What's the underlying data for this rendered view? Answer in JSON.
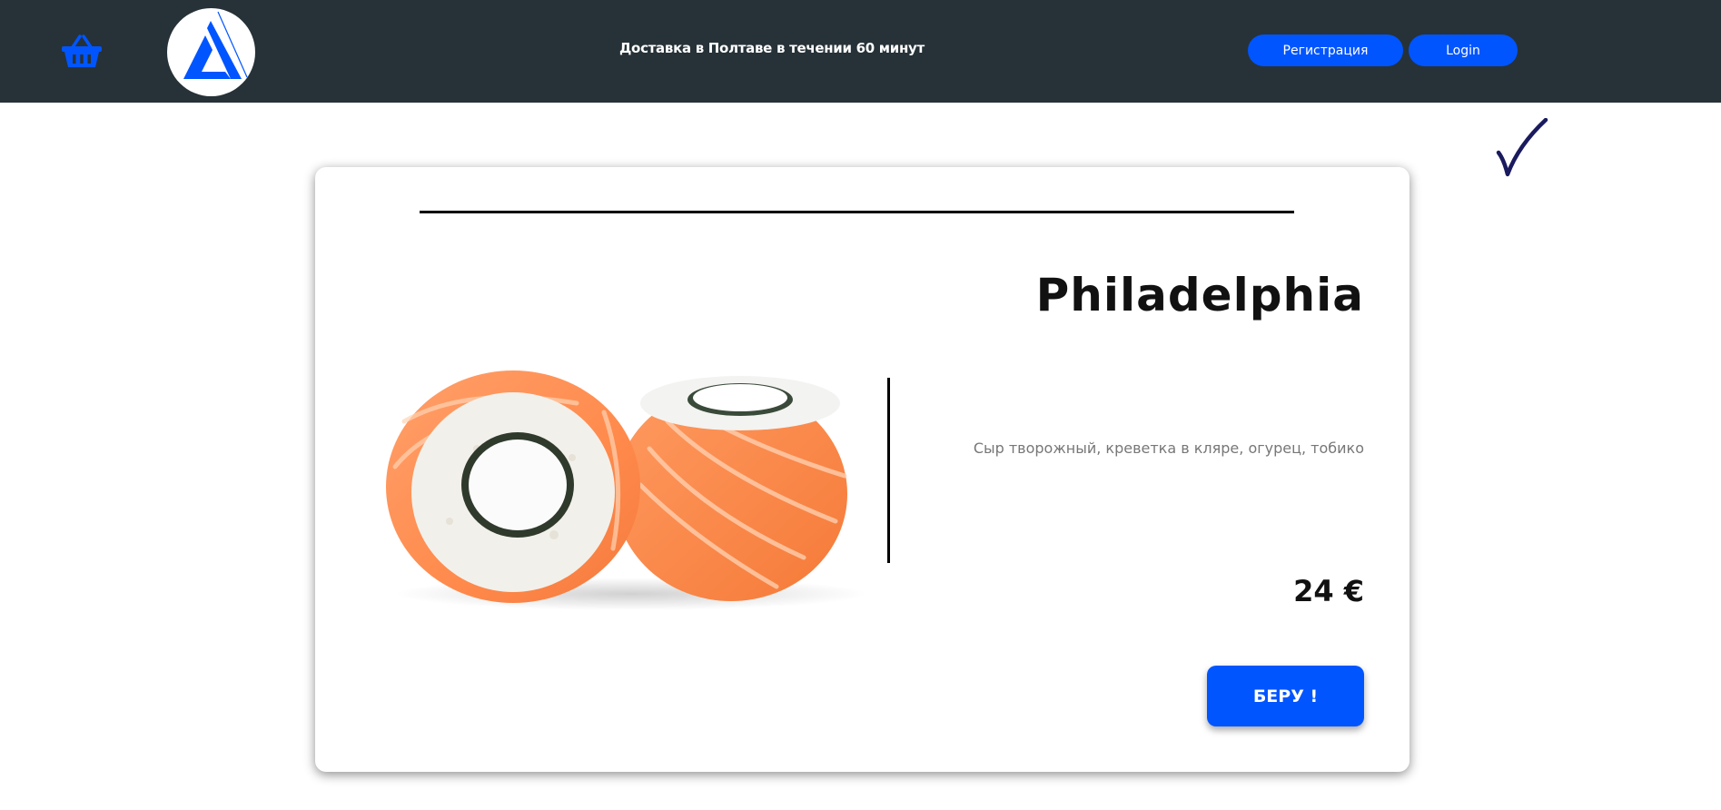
{
  "header": {
    "cart_icon": "shopping-basket-icon",
    "logo_icon": "triangle-logo-icon",
    "tagline": "Доставка в Полтаве в течении 60 минут",
    "register_label": "Регистрация",
    "login_label": "Login"
  },
  "decor": {
    "check_icon": "checkmark-icon",
    "check_color": "#1a1a5e"
  },
  "product": {
    "name": "Philadelphia",
    "description": "Сыр творожный, креветка в кляре, огурец, тобико",
    "price": "24 €",
    "buy_label": "БЕРУ !",
    "image_icon": "sushi-roll-image"
  },
  "colors": {
    "header_bg": "#263238",
    "accent": "#0055ff",
    "text_dark": "#111111",
    "text_muted": "#777777"
  }
}
